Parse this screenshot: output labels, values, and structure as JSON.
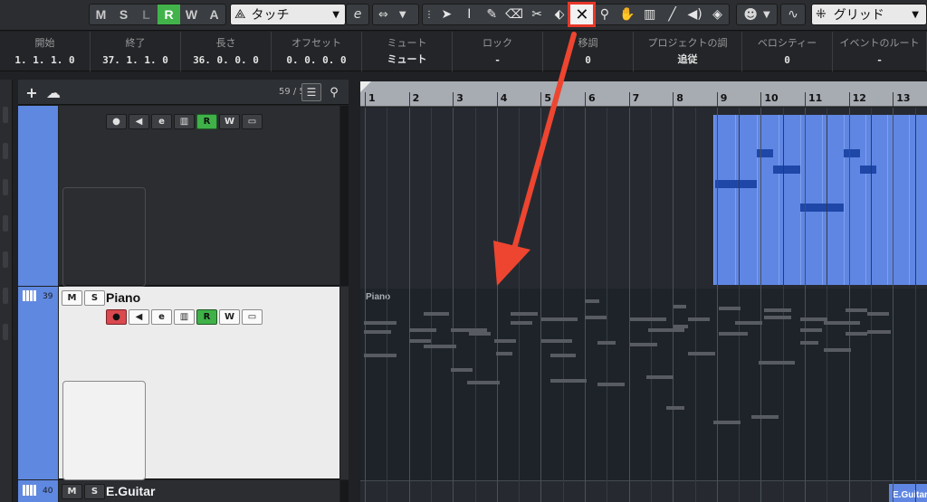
{
  "toolbar": {
    "mswra": [
      {
        "label": "M",
        "state": "normal"
      },
      {
        "label": "S",
        "state": "normal"
      },
      {
        "label": "L",
        "state": "dim"
      },
      {
        "label": "R",
        "state": "on"
      },
      {
        "label": "W",
        "state": "normal"
      },
      {
        "label": "A",
        "state": "normal"
      }
    ],
    "automation_mode_label": "タッチ",
    "automation_mode_icon": "automation-icon",
    "grid_label": "グリッド",
    "selected_tool": "mute-tool",
    "tools": [
      "object-select-tool",
      "range-tool",
      "draw-tool",
      "erase-tool",
      "split-tool",
      "glue-tool",
      "mute-tool",
      "zoom-tool",
      "hand-tool",
      "comp-tool",
      "line-tool",
      "play-tool",
      "color-tool"
    ],
    "accent_color": "#42b34b",
    "highlight_color": "#e8372a"
  },
  "infoline": [
    {
      "header": "開始",
      "value": "1. 1. 1.   0",
      "w": 100
    },
    {
      "header": "終了",
      "value": "37. 1. 1.   0",
      "w": 100
    },
    {
      "header": "長さ",
      "value": "36. 0. 0.   0",
      "w": 100
    },
    {
      "header": "オフセット",
      "value": "0. 0. 0.   0",
      "w": 100
    },
    {
      "header": "ミュート",
      "value": "ミュート",
      "w": 100
    },
    {
      "header": "ロック",
      "value": "-",
      "w": 100
    },
    {
      "header": "移調",
      "value": "0",
      "w": 100
    },
    {
      "header": "プロジェクトの調",
      "value": "追従",
      "w": 120
    },
    {
      "header": "ベロシティー",
      "value": "0",
      "w": 100
    },
    {
      "header": "イベントのルート",
      "value": "-",
      "w": 104
    }
  ],
  "tracklist": {
    "count": "59 / 59"
  },
  "tracks": [
    {
      "number": "",
      "name": "",
      "record_armed": false
    },
    {
      "number": "39",
      "name": "Piano",
      "record_armed": true
    },
    {
      "number": "40",
      "name": "E.Guitar",
      "record_armed": false
    }
  ],
  "track_buttons": {
    "mute": "M",
    "solo": "S",
    "read": "R",
    "write": "W",
    "edit": "e"
  },
  "ruler": {
    "bars": [
      "1",
      "2",
      "3",
      "4",
      "5",
      "6",
      "7",
      "8",
      "9",
      "10",
      "11",
      "12",
      "13"
    ]
  },
  "regions": {
    "piano_label": "Piano",
    "egtr_label": "E.Guitar"
  },
  "colors": {
    "track_color": "#5f88e0",
    "midi_region": "#5f86e2",
    "midi_note": "#1e47a8",
    "record_button": "#d9494f",
    "read_button": "#3fb148"
  }
}
